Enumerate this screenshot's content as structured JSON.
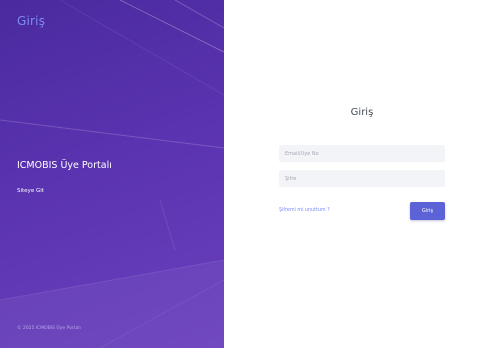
{
  "left_panel": {
    "brand": "Giriş",
    "portal_title": "ICMOBIS Üye Portalı",
    "site_link": "Siteye Git",
    "copyright": "© 2025 ICMOBIS Üye Portalı"
  },
  "login_form": {
    "title": "Giriş",
    "username_placeholder": "Email/Üye No",
    "password_placeholder": "Şifre",
    "forgot_link": "Şifremi mi unuttum ?",
    "submit_label": "Giriş"
  },
  "colors": {
    "panel_purple": "#5a33b0",
    "accent_button": "#5b63d6",
    "brand_text": "#7d8cf0"
  }
}
